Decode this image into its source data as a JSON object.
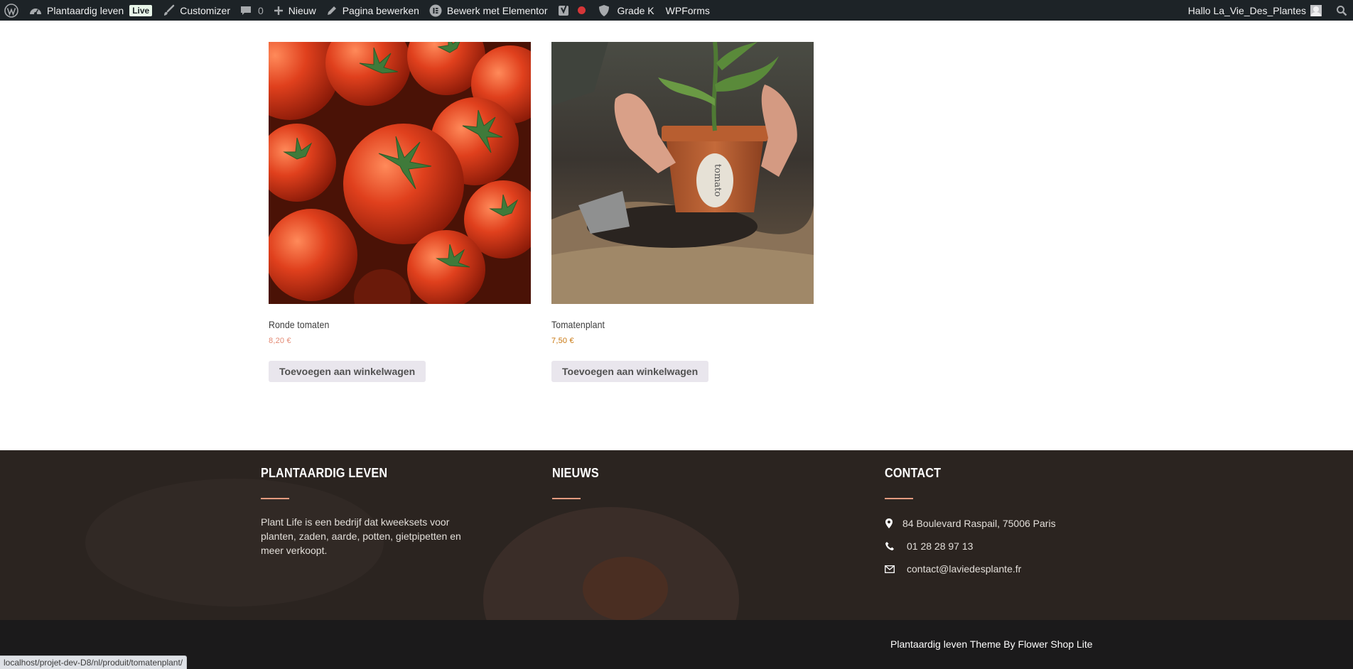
{
  "adminbar": {
    "wp_logo": "wordpress-icon",
    "site_name": "Plantaardig leven",
    "live_badge": "Live",
    "customizer": "Customizer",
    "comments_count": "0",
    "new": "Nieuw",
    "edit_page": "Pagina bewerken",
    "elementor": "Bewerk met Elementor",
    "grade": "Grade K",
    "wpforms": "WPForms",
    "greeting": "Hallo La_Vie_Des_Plantes"
  },
  "products": [
    {
      "title": "Ronde tomaten",
      "price": "8,20 €",
      "price_color": "#e38973",
      "button": "Toevoegen aan winkelwagen"
    },
    {
      "title": "Tomatenplant",
      "price": "7,50 €",
      "price_color": "#c8760d",
      "button": "Toevoegen aan winkelwagen"
    }
  ],
  "footer": {
    "about": {
      "heading": "PLANTAARDIG LEVEN",
      "text": "Plant Life is een bedrijf dat kweeksets voor planten, zaden, aarde, potten, gietpipetten en meer verkoopt."
    },
    "news": {
      "heading": "NIEUWS"
    },
    "contact": {
      "heading": "CONTACT",
      "address": "84 Boulevard Raspail, 75006 Paris",
      "phone": "01 28 28 97 13",
      "email": "contact@laviedesplante.fr"
    },
    "credit": "Plantaardig leven Theme By Flower Shop Lite",
    "accent_color": "#e59b80"
  },
  "status_url": "localhost/projet-dev-D8/nl/produit/tomatenplant/"
}
